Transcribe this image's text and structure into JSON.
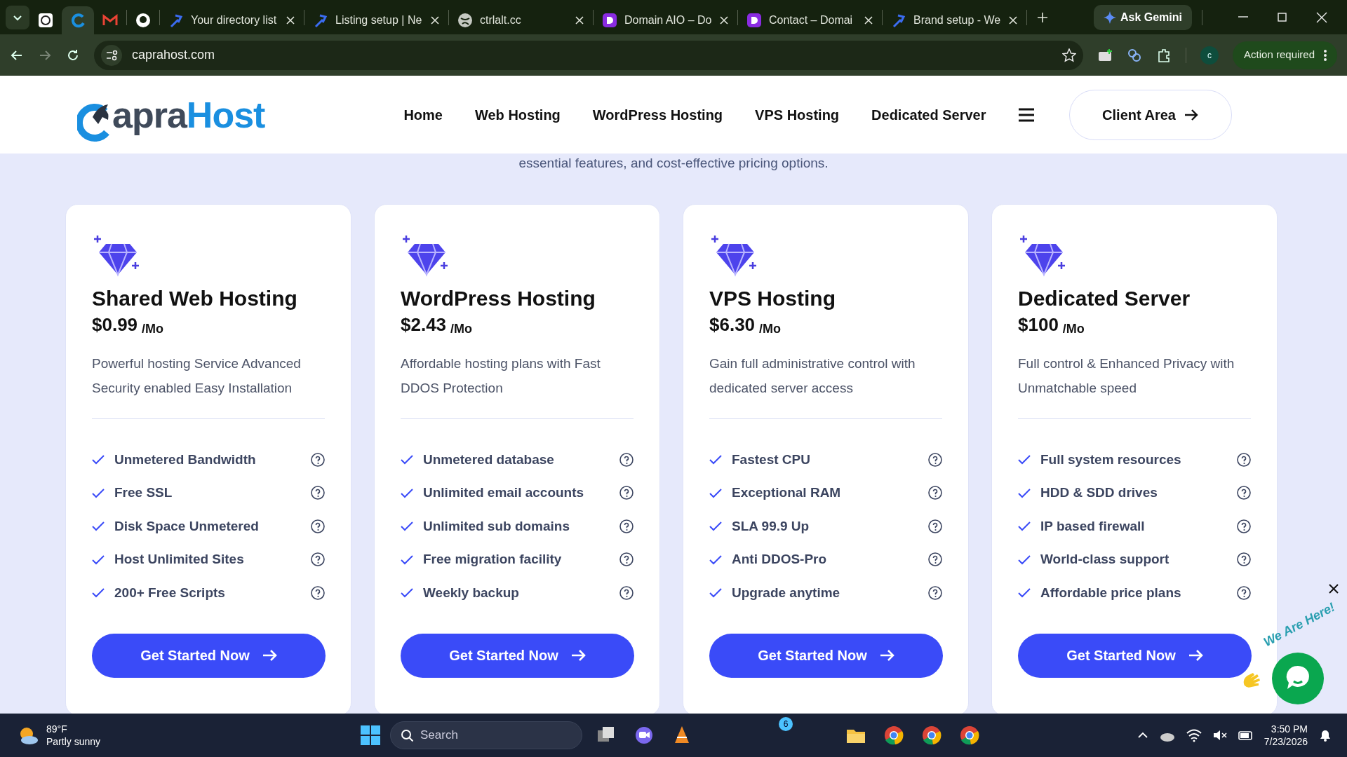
{
  "browser": {
    "tabs": [
      {
        "selected": false
      },
      {
        "selected": true
      },
      {
        "selected": false
      },
      {
        "selected": false
      },
      {
        "title": "Your directory list",
        "selected": false
      },
      {
        "title": "Listing setup | Ne",
        "selected": false
      },
      {
        "title": "ctrlalt.cc",
        "selected": false
      },
      {
        "title": "Domain AIO – Do",
        "selected": false
      },
      {
        "title": "Contact – Domai",
        "selected": false
      },
      {
        "title": "Brand setup - We",
        "selected": false
      }
    ],
    "gemini_button": "Ask Gemini",
    "address": "caprahost.com",
    "profile": "c",
    "action_button": "Action required"
  },
  "site": {
    "logo": {
      "part_1": "apra",
      "part_2": "Host"
    },
    "nav": [
      "Home",
      "Web Hosting",
      "WordPress Hosting",
      "VPS Hosting",
      "Dedicated Server"
    ],
    "client_button": "Client Area",
    "intro_text": "essential features, and cost-effective pricing options.",
    "plans": [
      {
        "title": "Shared Web Hosting",
        "price": "$0.99",
        "period": "/Mo",
        "description": "Powerful hosting Service Advanced Security enabled Easy Installation",
        "features": [
          "Unmetered Bandwidth",
          "Free SSL",
          "Disk Space Unmetered",
          "Host Unlimited Sites",
          "200+ Free Scripts"
        ],
        "button": "Get Started Now"
      },
      {
        "title": "WordPress Hosting",
        "price": "$2.43",
        "period": "/Mo",
        "description": "Affordable hosting plans with Fast DDOS Protection",
        "features": [
          "Unmetered database",
          "Unlimited email accounts",
          "Unlimited sub domains",
          "Free migration facility",
          "Weekly backup"
        ],
        "button": "Get Started Now"
      },
      {
        "title": "VPS Hosting",
        "price": "$6.30",
        "period": "/Mo",
        "description": "Gain full administrative control with dedicated server access",
        "features": [
          "Fastest CPU",
          "Exceptional RAM",
          "SLA 99.9 Up",
          "Anti DDOS-Pro",
          "Upgrade anytime"
        ],
        "button": "Get Started Now"
      },
      {
        "title": "Dedicated Server",
        "price": "$100",
        "period": "/Mo",
        "description": "Full control & Enhanced Privacy with Unmatchable speed",
        "features": [
          "Full system resources",
          "HDD & SDD drives",
          "IP based firewall",
          "World-class support",
          "Affordable price plans"
        ],
        "button": "Get Started Now"
      }
    ],
    "chat_widget": {
      "caption": "We Are Here!"
    }
  },
  "taskbar": {
    "temperature": "89°F",
    "weather": "Partly sunny",
    "search_placeholder": "Search",
    "badge": "6",
    "time": "3:50 PM",
    "date": "7/23/2026"
  }
}
